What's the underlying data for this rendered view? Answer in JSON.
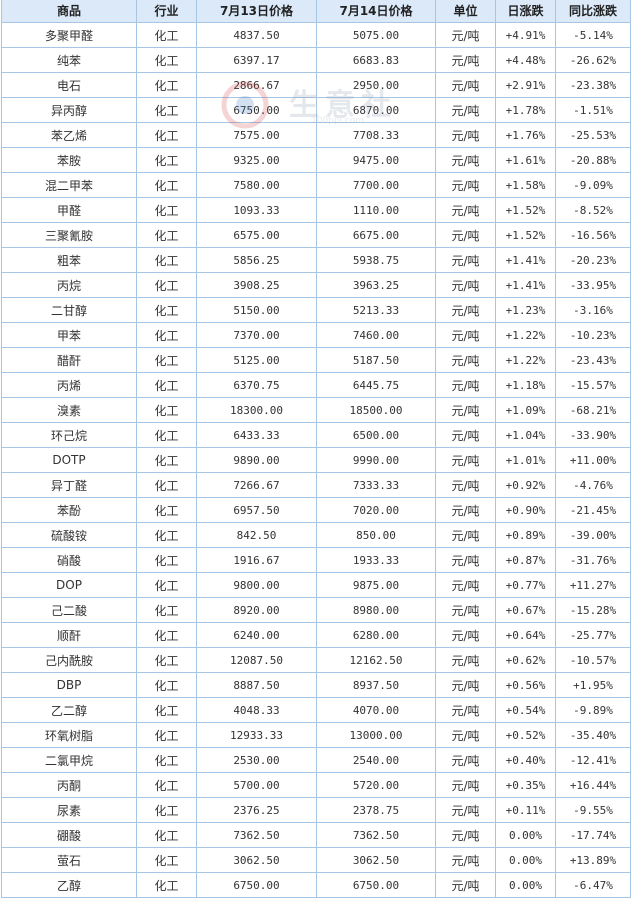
{
  "table": {
    "headers": [
      "商品",
      "行业",
      "7月13日价格",
      "7月14日价格",
      "单位",
      "日涨跌",
      "同比涨跌"
    ],
    "rows": [
      [
        "多聚甲醛",
        "化工",
        "4837.50",
        "5075.00",
        "元/吨",
        "+4.91%",
        "-5.14%"
      ],
      [
        "纯苯",
        "化工",
        "6397.17",
        "6683.83",
        "元/吨",
        "+4.48%",
        "-26.62%"
      ],
      [
        "电石",
        "化工",
        "2866.67",
        "2950.00",
        "元/吨",
        "+2.91%",
        "-23.38%"
      ],
      [
        "异丙醇",
        "化工",
        "6750.00",
        "6870.00",
        "元/吨",
        "+1.78%",
        "-1.51%"
      ],
      [
        "苯乙烯",
        "化工",
        "7575.00",
        "7708.33",
        "元/吨",
        "+1.76%",
        "-25.53%"
      ],
      [
        "苯胺",
        "化工",
        "9325.00",
        "9475.00",
        "元/吨",
        "+1.61%",
        "-20.88%"
      ],
      [
        "混二甲苯",
        "化工",
        "7580.00",
        "7700.00",
        "元/吨",
        "+1.58%",
        "-9.09%"
      ],
      [
        "甲醛",
        "化工",
        "1093.33",
        "1110.00",
        "元/吨",
        "+1.52%",
        "-8.52%"
      ],
      [
        "三聚氰胺",
        "化工",
        "6575.00",
        "6675.00",
        "元/吨",
        "+1.52%",
        "-16.56%"
      ],
      [
        "粗苯",
        "化工",
        "5856.25",
        "5938.75",
        "元/吨",
        "+1.41%",
        "-20.23%"
      ],
      [
        "丙烷",
        "化工",
        "3908.25",
        "3963.25",
        "元/吨",
        "+1.41%",
        "-33.95%"
      ],
      [
        "二甘醇",
        "化工",
        "5150.00",
        "5213.33",
        "元/吨",
        "+1.23%",
        "-3.16%"
      ],
      [
        "甲苯",
        "化工",
        "7370.00",
        "7460.00",
        "元/吨",
        "+1.22%",
        "-10.23%"
      ],
      [
        "醋酐",
        "化工",
        "5125.00",
        "5187.50",
        "元/吨",
        "+1.22%",
        "-23.43%"
      ],
      [
        "丙烯",
        "化工",
        "6370.75",
        "6445.75",
        "元/吨",
        "+1.18%",
        "-15.57%"
      ],
      [
        "溴素",
        "化工",
        "18300.00",
        "18500.00",
        "元/吨",
        "+1.09%",
        "-68.21%"
      ],
      [
        "环己烷",
        "化工",
        "6433.33",
        "6500.00",
        "元/吨",
        "+1.04%",
        "-33.90%"
      ],
      [
        "DOTP",
        "化工",
        "9890.00",
        "9990.00",
        "元/吨",
        "+1.01%",
        "+11.00%"
      ],
      [
        "异丁醛",
        "化工",
        "7266.67",
        "7333.33",
        "元/吨",
        "+0.92%",
        "-4.76%"
      ],
      [
        "苯酚",
        "化工",
        "6957.50",
        "7020.00",
        "元/吨",
        "+0.90%",
        "-21.45%"
      ],
      [
        "硫酸铵",
        "化工",
        "842.50",
        "850.00",
        "元/吨",
        "+0.89%",
        "-39.00%"
      ],
      [
        "硝酸",
        "化工",
        "1916.67",
        "1933.33",
        "元/吨",
        "+0.87%",
        "-31.76%"
      ],
      [
        "DOP",
        "化工",
        "9800.00",
        "9875.00",
        "元/吨",
        "+0.77%",
        "+11.27%"
      ],
      [
        "己二酸",
        "化工",
        "8920.00",
        "8980.00",
        "元/吨",
        "+0.67%",
        "-15.28%"
      ],
      [
        "顺酐",
        "化工",
        "6240.00",
        "6280.00",
        "元/吨",
        "+0.64%",
        "-25.77%"
      ],
      [
        "己内酰胺",
        "化工",
        "12087.50",
        "12162.50",
        "元/吨",
        "+0.62%",
        "-10.57%"
      ],
      [
        "DBP",
        "化工",
        "8887.50",
        "8937.50",
        "元/吨",
        "+0.56%",
        "+1.95%"
      ],
      [
        "乙二醇",
        "化工",
        "4048.33",
        "4070.00",
        "元/吨",
        "+0.54%",
        "-9.89%"
      ],
      [
        "环氧树脂",
        "化工",
        "12933.33",
        "13000.00",
        "元/吨",
        "+0.52%",
        "-35.40%"
      ],
      [
        "二氯甲烷",
        "化工",
        "2530.00",
        "2540.00",
        "元/吨",
        "+0.40%",
        "-12.41%"
      ],
      [
        "丙酮",
        "化工",
        "5700.00",
        "5720.00",
        "元/吨",
        "+0.35%",
        "+16.44%"
      ],
      [
        "尿素",
        "化工",
        "2376.25",
        "2378.75",
        "元/吨",
        "+0.11%",
        "-9.55%"
      ],
      [
        "硼酸",
        "化工",
        "7362.50",
        "7362.50",
        "元/吨",
        "0.00%",
        "-17.74%"
      ],
      [
        "萤石",
        "化工",
        "3062.50",
        "3062.50",
        "元/吨",
        "0.00%",
        "+13.89%"
      ],
      [
        "乙醇",
        "化工",
        "6750.00",
        "6750.00",
        "元/吨",
        "0.00%",
        "-6.47%"
      ]
    ]
  },
  "colors": {
    "header_bg": "#dbe9f8",
    "border": "#a6c6e6",
    "up": "#e00000",
    "down": "#008000",
    "neutral": "#333333"
  },
  "watermark": {
    "text": "生意社",
    "url": "100ppi.com",
    "icon": "logo-mark-icon"
  }
}
